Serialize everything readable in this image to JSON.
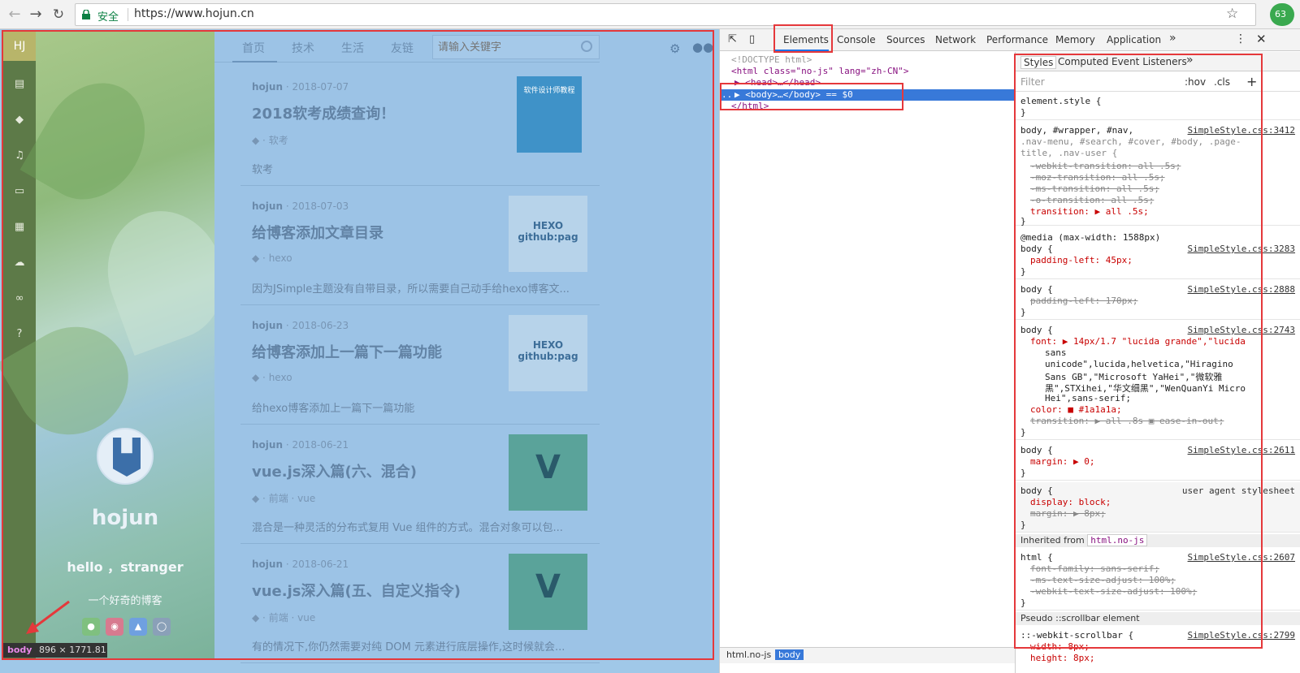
{
  "browser": {
    "secure_label": "安全",
    "url": "https://www.hojun.cn",
    "extension_badge": "63"
  },
  "page": {
    "logo": "HJ",
    "profile": {
      "name": "hojun",
      "greeting": "hello ，stranger",
      "motto": "一个好奇的博客"
    },
    "nav": {
      "items": [
        "首页",
        "技术",
        "生活",
        "友链"
      ],
      "search_placeholder": "请输入关键字"
    },
    "posts": [
      {
        "author": "hojun",
        "date": "2018-07-07",
        "title": "2018软考成绩查询！",
        "tags": [
          "软考"
        ],
        "excerpt": "软考",
        "thumb": "book",
        "thumb_label": "软件设计师教程"
      },
      {
        "author": "hojun",
        "date": "2018-07-03",
        "title": "给博客添加文章目录",
        "tags": [
          "hexo"
        ],
        "excerpt": "因为JSimple主题没有自带目录，所以需要自己动手给hexo博客文...",
        "thumb": "hexo",
        "thumb_label": "HEXO github:pag"
      },
      {
        "author": "hojun",
        "date": "2018-06-23",
        "title": "给博客添加上一篇下一篇功能",
        "tags": [
          "hexo"
        ],
        "excerpt": "给hexo博客添加上一篇下一篇功能",
        "thumb": "hexo",
        "thumb_label": "HEXO github:pag"
      },
      {
        "author": "hojun",
        "date": "2018-06-21",
        "title": "vue.js深入篇(六、混合)",
        "tags": [
          "前端",
          "vue"
        ],
        "excerpt": "混合是一种灵活的分布式复用 Vue 组件的方式。混合对象可以包...",
        "thumb": "vue",
        "thumb_label": "V"
      },
      {
        "author": "hojun",
        "date": "2018-06-21",
        "title": "vue.js深入篇(五、自定义指令)",
        "tags": [
          "前端",
          "vue"
        ],
        "excerpt": "有的情况下,你仍然需要对纯 DOM 元素进行底层操作,这时候就会...",
        "thumb": "vue",
        "thumb_label": "V"
      }
    ],
    "tooltip": {
      "tag": "body",
      "size": "896 × 1771.81"
    }
  },
  "devtools": {
    "tabs": [
      "Elements",
      "Console",
      "Sources",
      "Network",
      "Performance",
      "Memory",
      "Application"
    ],
    "more": "»",
    "active_tab": "Elements",
    "dom": [
      "<!DOCTYPE html>",
      "<html class=\"no-js\" lang=\"zh-CN\">",
      "▶ <head>…</head>",
      "▶ <body>…</body> == $0",
      "</html>"
    ],
    "dom_ellipsis": "...",
    "breadcrumb": [
      "html.no-js",
      "body"
    ],
    "styles_tabs": [
      "Styles",
      "Computed",
      "Event Listeners"
    ],
    "filter": {
      "placeholder": "Filter",
      "hov": ":hov",
      "cls": ".cls",
      "plus": "+"
    },
    "rules": [
      {
        "id": "r0",
        "lines": [
          "element.style {",
          "}"
        ]
      },
      {
        "id": "r1",
        "source": "SimpleStyle.css:3412",
        "lines": [
          "body, #wrapper, #nav,",
          ".nav-menu, #search, #cover, #body, .page-",
          "title, .nav-user {"
        ]
      },
      {
        "id": "r1p",
        "lines": [
          "-webkit-transition: all .5s;",
          "-moz-transition: all .5s;",
          "-ms-transition: all .5s;",
          "-o-transition: all .5s;",
          "transition: ▶ all .5s;",
          "}"
        ]
      },
      {
        "id": "r2",
        "lines": [
          "@media (max-width: 1588px)",
          "body {",
          "padding-left: 45px;",
          "}"
        ],
        "source": "SimpleStyle.css:3283"
      },
      {
        "id": "r3",
        "lines": [
          "body {",
          "padding-left: 170px;",
          "}"
        ],
        "source": "SimpleStyle.css:2888"
      },
      {
        "id": "r4",
        "lines": [
          "body {",
          "font: ▶ 14px/1.7 \"lucida grande\",\"lucida",
          "sans",
          "unicode\",lucida,helvetica,\"Hiragino",
          "Sans GB\",\"Microsoft YaHei\",\"微软雅",
          "黑\",STXihei,\"华文细黑\",\"WenQuanYi Micro",
          "Hei\",sans-serif;",
          "color: ■ #1a1a1a;",
          "transition: ▶ all .8s ▣ ease-in-out;",
          "}"
        ],
        "source": "SimpleStyle.css:2743"
      },
      {
        "id": "r5",
        "lines": [
          "body {",
          "margin: ▶ 0;",
          "}"
        ],
        "source": "SimpleStyle.css:2611"
      },
      {
        "id": "r6",
        "lines": [
          "body {",
          "display: block;",
          "margin: ▶ 8px;",
          "}"
        ],
        "source": "user agent stylesheet"
      },
      {
        "id": "r7",
        "lines": [
          "Inherited from",
          "html.no-js"
        ]
      },
      {
        "id": "r8",
        "lines": [
          "html {",
          "font-family: sans-serif;",
          "-ms-text-size-adjust: 100%;",
          "-webkit-text-size-adjust: 100%;",
          "}"
        ],
        "source": "SimpleStyle.css:2607"
      },
      {
        "id": "r9",
        "lines": [
          "Pseudo ::scrollbar element",
          "::-webkit-scrollbar {",
          "width: 8px;",
          "height: 8px;"
        ],
        "source": "SimpleStyle.css:2799"
      }
    ]
  }
}
